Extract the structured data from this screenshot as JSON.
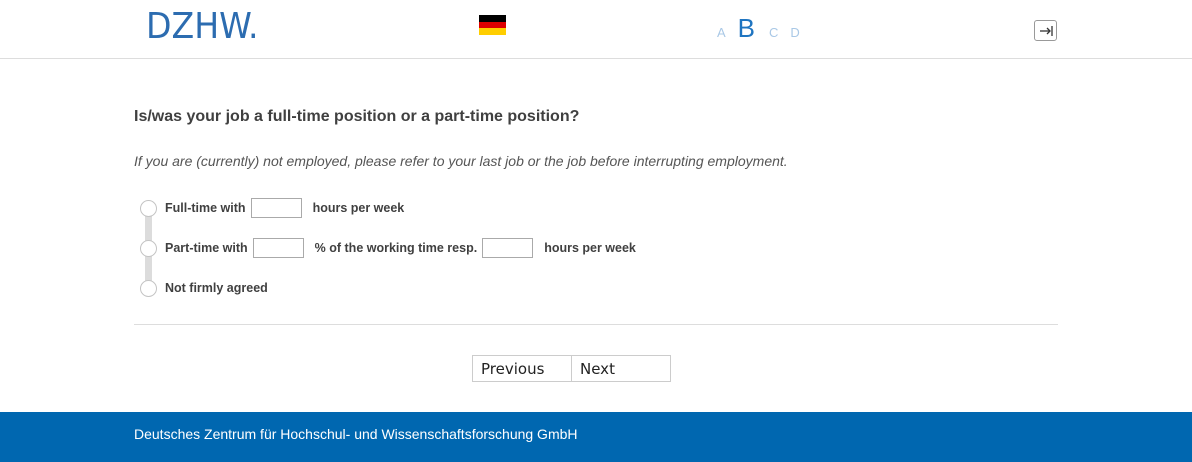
{
  "header": {
    "logo_text": "DZHW.",
    "language_flag": "german-flag-icon",
    "flag_colors": [
      "#000000",
      "#dd0000",
      "#ffce00"
    ],
    "font_size_options": [
      {
        "label": "A",
        "active": false
      },
      {
        "label": "B",
        "active": true
      },
      {
        "label": "C",
        "active": false
      },
      {
        "label": "D",
        "active": false
      }
    ],
    "logout_icon": "logout-arrow-icon"
  },
  "question": {
    "text": "Is/was your job a full-time position or a part-time position?",
    "instruction": "If you are (currently) not employed, please refer to your last job or the job before interrupting employment."
  },
  "options": [
    {
      "label": "Full-time with",
      "suffix": "hours per week",
      "field_value": ""
    },
    {
      "label": "Part-time with",
      "middle": "% of the working time resp.",
      "suffix": "hours per week",
      "field1_value": "",
      "field2_value": ""
    },
    {
      "label": "Not firmly agreed"
    }
  ],
  "nav": {
    "previous_label": "Previous",
    "next_label": "Next"
  },
  "footer": {
    "text": "Deutsches Zentrum für Hochschul- und Wissenschaftsforschung GmbH",
    "background_color": "#0067b0"
  },
  "accent_color": "#2c6cb0"
}
